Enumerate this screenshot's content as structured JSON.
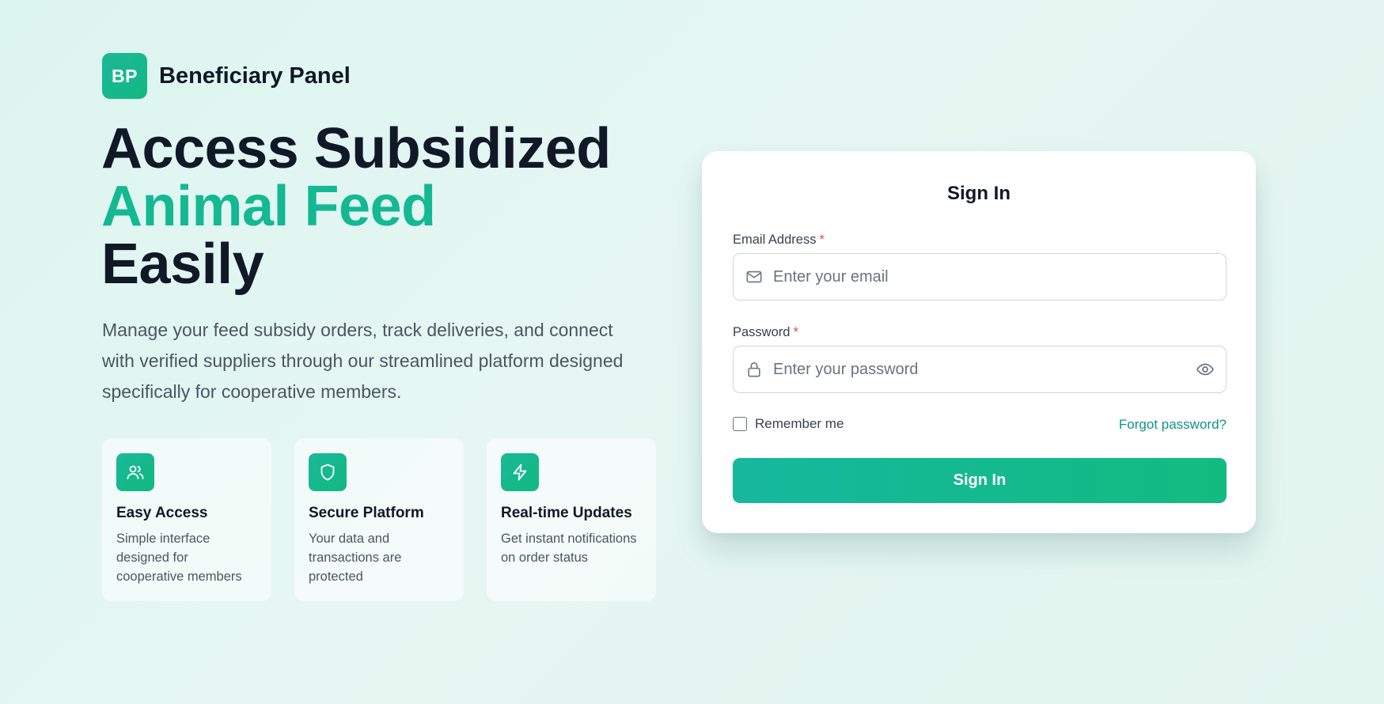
{
  "brand": {
    "badge": "BP",
    "name": "Beneficiary Panel"
  },
  "hero": {
    "line1": "Access Subsidized",
    "line2": "Animal Feed",
    "line3": "Easily",
    "description": "Manage your feed subsidy orders, track deliveries, and connect with verified suppliers through our streamlined platform designed specifically for cooperative members."
  },
  "features": [
    {
      "icon": "users-icon",
      "title": "Easy Access",
      "description": "Simple interface designed for cooperative members"
    },
    {
      "icon": "shield-icon",
      "title": "Secure Platform",
      "description": "Your data and transactions are protected"
    },
    {
      "icon": "lightning-icon",
      "title": "Real-time Updates",
      "description": "Get instant notifications on order status"
    }
  ],
  "signin": {
    "title": "Sign In",
    "email": {
      "label": "Email Address",
      "required": "*",
      "placeholder": "Enter your email",
      "value": ""
    },
    "password": {
      "label": "Password",
      "required": "*",
      "placeholder": "Enter your password",
      "value": ""
    },
    "remember_label": "Remember me",
    "forgot_label": "Forgot password?",
    "submit_label": "Sign In"
  },
  "colors": {
    "accent": "#14b893",
    "heading": "#111827",
    "link": "#0d9488",
    "required": "#ef4444"
  }
}
